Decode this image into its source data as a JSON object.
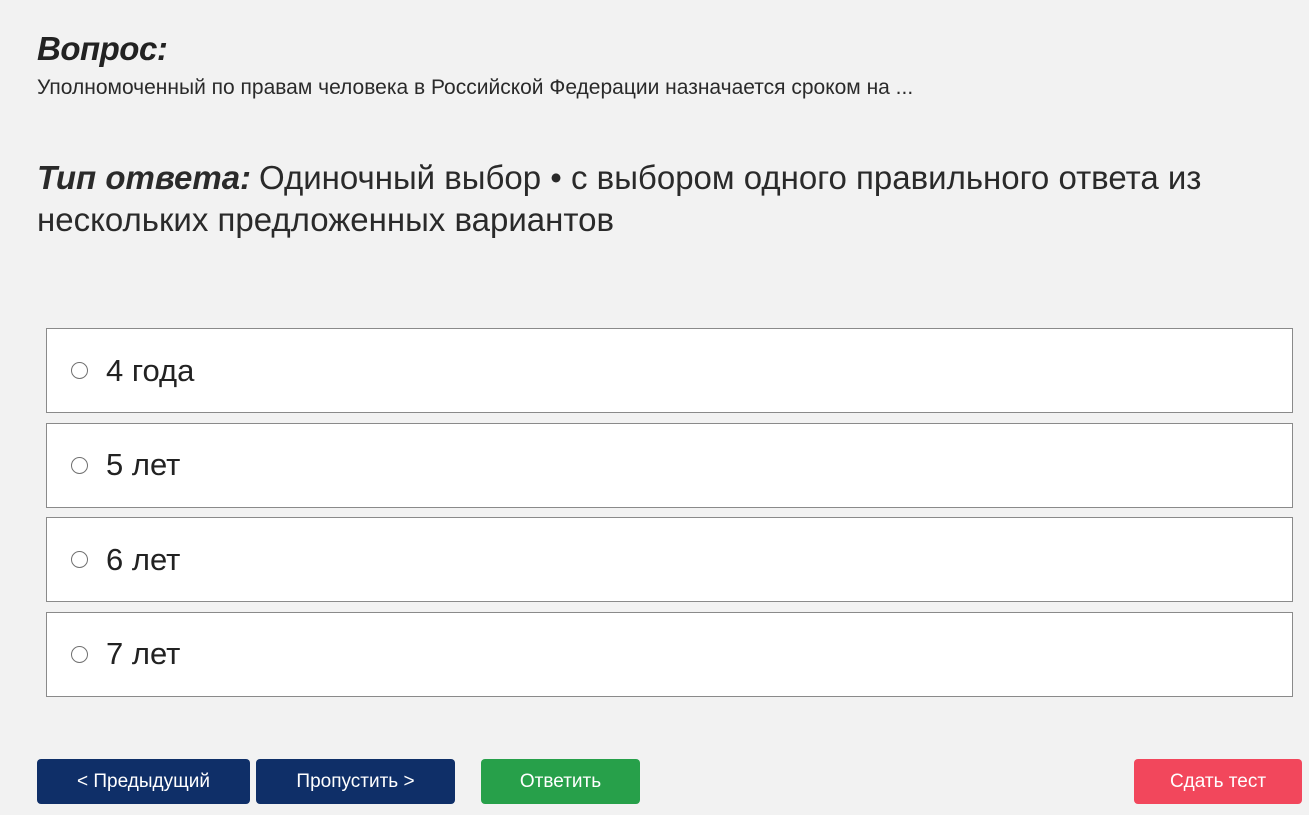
{
  "question": {
    "heading": "Вопрос:",
    "text": "Уполномоченный по правам человека в Российской Федерации назначается сроком на ..."
  },
  "answer_type": {
    "label": "Тип ответа:",
    "value": "Одиночный выбор • с выбором одного правильного ответа из нескольких предложенных вариантов"
  },
  "options": [
    {
      "label": "4 года",
      "selected": false
    },
    {
      "label": "5 лет",
      "selected": false
    },
    {
      "label": "6 лет",
      "selected": false
    },
    {
      "label": "7 лет",
      "selected": false
    }
  ],
  "buttons": {
    "prev": "< Предыдущий",
    "skip": "Пропустить >",
    "answer": "Ответить",
    "submit": "Сдать тест"
  },
  "colors": {
    "background": "#f2f2f2",
    "nav_button": "#0f2f68",
    "answer_button": "#27a04a",
    "submit_button": "#f2475c"
  }
}
